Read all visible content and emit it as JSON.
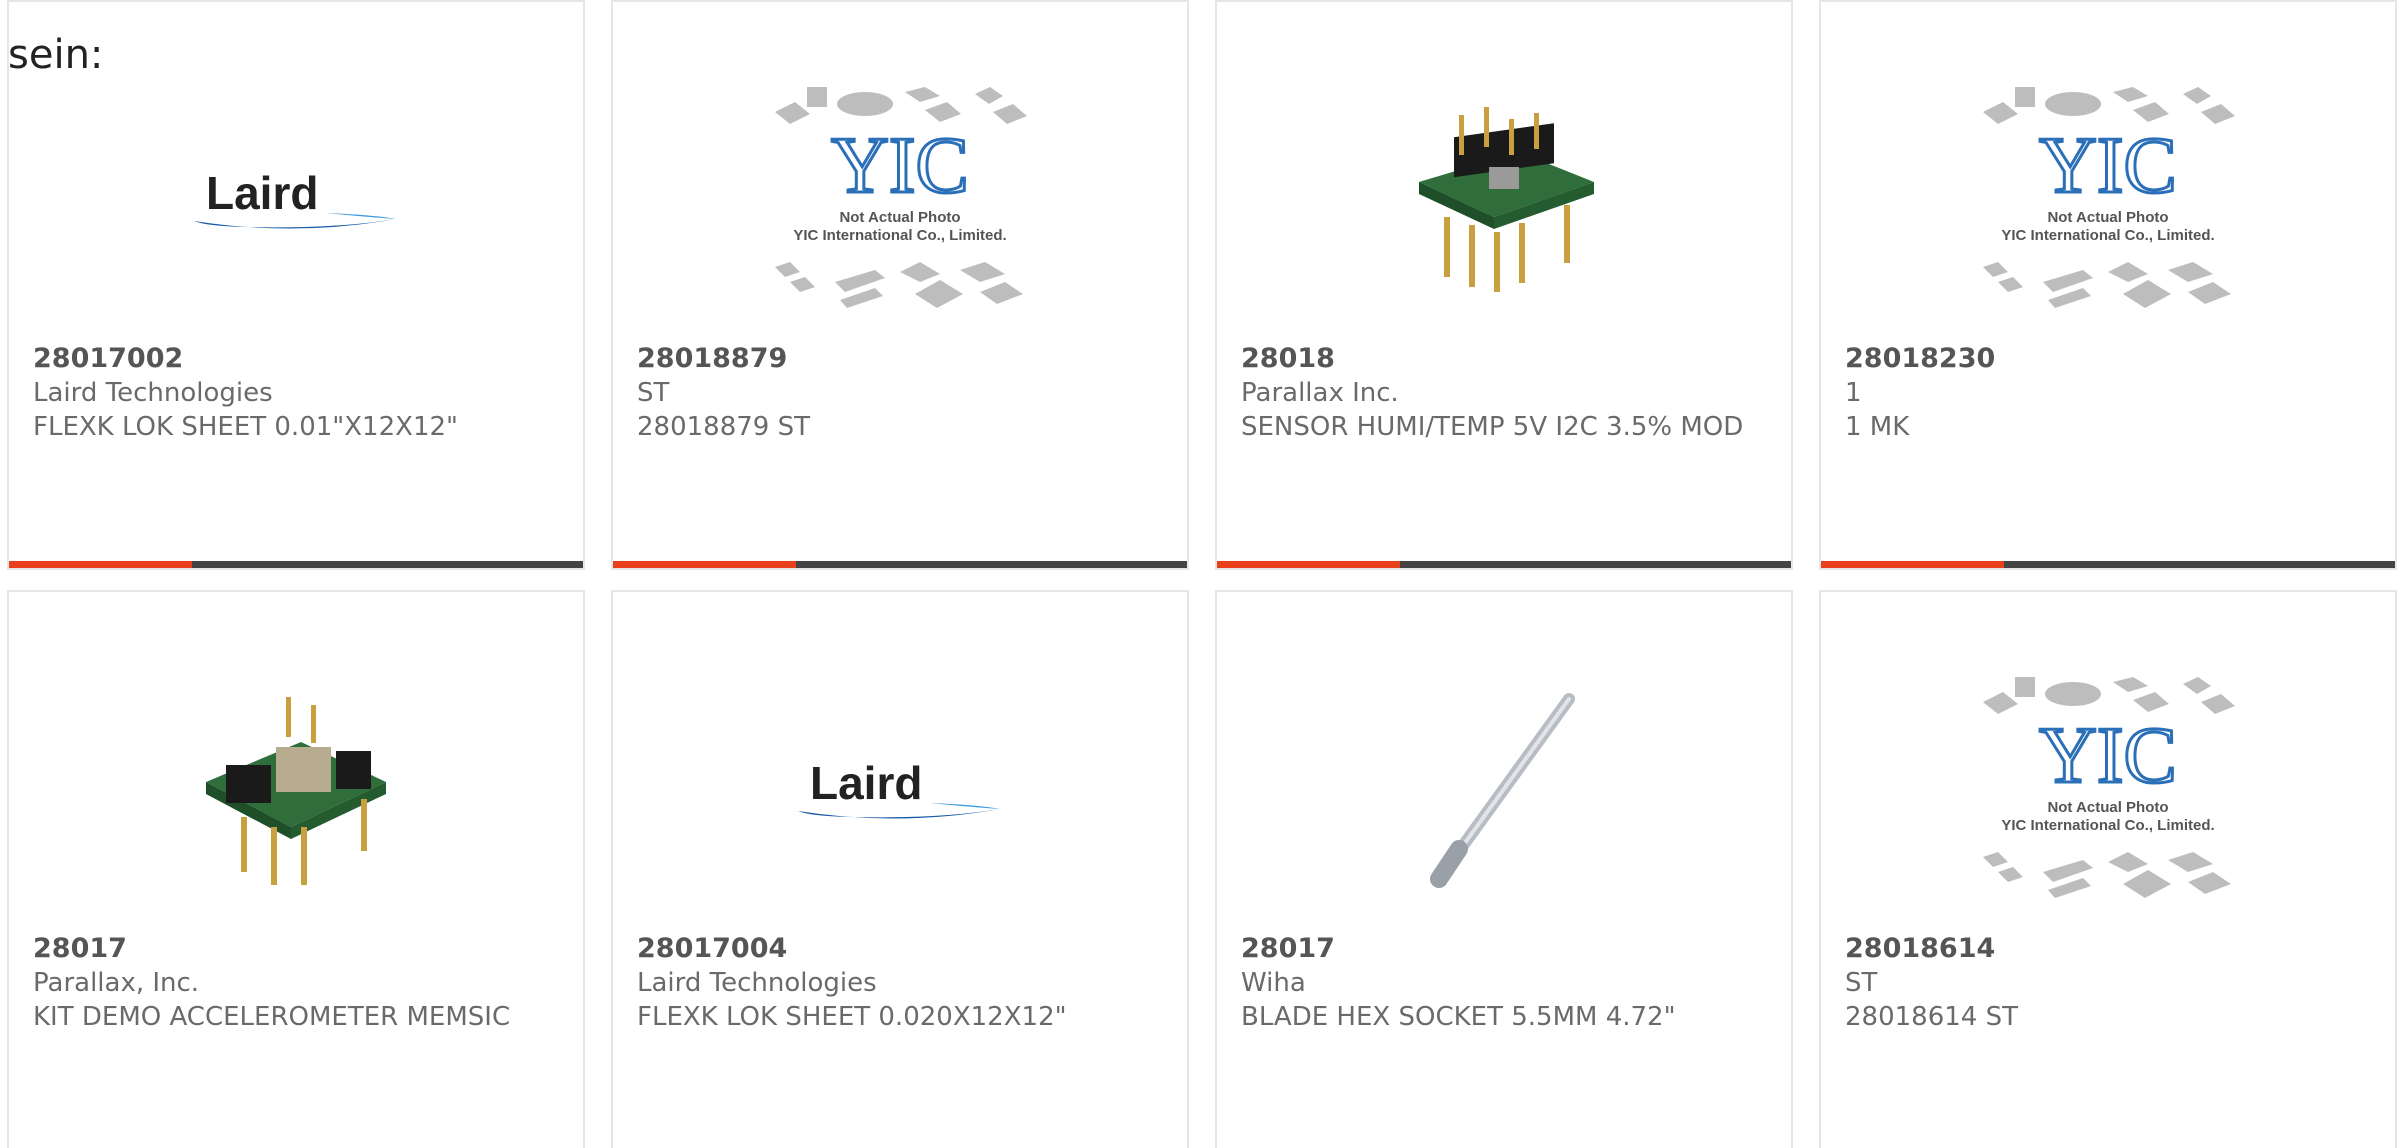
{
  "heading": "sein:",
  "colors": {
    "accent": "#e8401c",
    "bar": "#444444",
    "border": "#e6e6e6",
    "text": "#6a6a6a",
    "laird_blue": "#1a5aa8",
    "yic_blue": "#2a6fb8"
  },
  "yic_placeholder": {
    "logo": "YIC",
    "line1": "Not Actual Photo",
    "line2": "YIC International Co., Limited."
  },
  "products": [
    {
      "part": "28017002",
      "maker": "Laird Technologies",
      "desc": "FLEXK LOK SHEET 0.01\"X12X12\"",
      "image": "laird-logo"
    },
    {
      "part": "28018879",
      "maker": "ST",
      "desc": "28018879 ST",
      "image": "yic-placeholder"
    },
    {
      "part": "28018",
      "maker": "Parallax Inc.",
      "desc": "SENSOR HUMI/TEMP 5V I2C 3.5% MOD",
      "image": "sensor-module-icon"
    },
    {
      "part": "28018230",
      "maker": "1",
      "desc": "1 MK",
      "image": "yic-placeholder"
    },
    {
      "part": "28017",
      "maker": "Parallax, Inc.",
      "desc": "KIT DEMO ACCELEROMETER MEMSIC",
      "image": "accelerometer-module-icon"
    },
    {
      "part": "28017004",
      "maker": "Laird Technologies",
      "desc": "FLEXK LOK SHEET 0.020X12X12\"",
      "image": "laird-logo"
    },
    {
      "part": "28017",
      "maker": "Wiha",
      "desc": "BLADE HEX SOCKET 5.5MM 4.72\"",
      "image": "hex-blade-icon"
    },
    {
      "part": "28018614",
      "maker": "ST",
      "desc": "28018614 ST",
      "image": "yic-placeholder"
    }
  ]
}
